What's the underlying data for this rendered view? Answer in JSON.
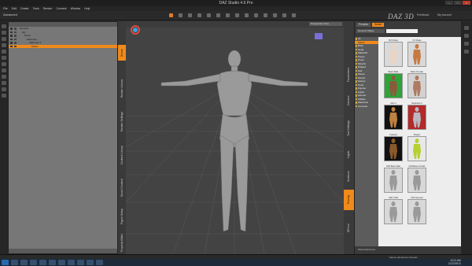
{
  "window": {
    "title": "DAZ Studio 4.6 Pro",
    "minimize": "–",
    "maximize": "□",
    "close": "×"
  },
  "menu": [
    "File",
    "Edit",
    "Create",
    "Tools",
    "Render",
    "Connect",
    "Window",
    "Help"
  ],
  "toolbar": {
    "layout": "Advanced",
    "logo": "DAZ 3D",
    "links": [
      "Feedback",
      "My Account"
    ]
  },
  "scene": {
    "rows": [
      {
        "label": "Genesis",
        "selected": false
      },
      {
        "label": "Hip",
        "selected": false
      },
      {
        "label": "Pelvis",
        "selected": false
      },
      {
        "label": "Abdomen",
        "selected": false
      },
      {
        "label": "Abdomen 2",
        "selected": false
      },
      {
        "label": "Chest",
        "selected": true
      }
    ]
  },
  "left_tabs": [
    "Scene",
    "Render Library",
    "Render Settings",
    "Content Library",
    "Smart Content",
    "Figure Setup",
    "Property Editor"
  ],
  "right_tabs": [
    "Parameters",
    "Camera",
    "Tool Settings",
    "Lights",
    "Surfaces",
    "Posing",
    "DForm"
  ],
  "viewport": {
    "camera": "Perspective View",
    "figure_color": "#9a9a9a",
    "grid_color": "#5a5a5a"
  },
  "library": {
    "tabs": [
      "Presets",
      "Smart"
    ],
    "active_tab": "Smart",
    "filter": "Genesis Shape",
    "tree": [
      {
        "label": "All",
        "selected": false
      },
      {
        "label": "Actors",
        "selected": true
      },
      {
        "label": "Body",
        "selected": false
      },
      {
        "label": "Head",
        "selected": false
      },
      {
        "label": "Materials",
        "selected": false
      },
      {
        "label": "Poses",
        "selected": false
      },
      {
        "label": "Props",
        "selected": false
      },
      {
        "label": "Morphs",
        "selected": false
      },
      {
        "label": "Shapes",
        "selected": false
      },
      {
        "label": "Hair",
        "selected": false
      },
      {
        "label": "Shoes",
        "selected": false
      },
      {
        "label": "Scripts",
        "selected": false
      },
      {
        "label": "Setups",
        "selected": false
      },
      {
        "label": "Tools",
        "selected": false
      },
      {
        "label": "Figures",
        "selected": false
      },
      {
        "label": "Lights",
        "selected": false
      },
      {
        "label": "Scenes",
        "selected": false
      },
      {
        "label": "Utilities",
        "selected": false
      },
      {
        "label": "Wardrobe",
        "selected": false
      },
      {
        "label": "Cameras",
        "selected": false
      }
    ],
    "items": [
      {
        "caption": "M4 Shape",
        "color": "#e9d5c5",
        "bg": "#d9d9d9"
      },
      {
        "caption": "V4 Shape",
        "color": "#c67a42",
        "bg": "#d9d9d9"
      },
      {
        "caption": "Basic Male",
        "color": "#8b5a3c",
        "bg": "#2fa23a"
      },
      {
        "caption": "Basic Female",
        "color": "#b07a62",
        "bg": "#d2d2d2"
      },
      {
        "caption": "Aiko 4",
        "color": "#c08040",
        "bg": "#111"
      },
      {
        "caption": "Stephanie 4",
        "color": "#b8b8c0",
        "bg": "#b22a2a"
      },
      {
        "caption": "Creature",
        "color": "#8a5a2a",
        "bg": "#111"
      },
      {
        "caption": "Dragon",
        "color": "#b8d030",
        "bg": "#e8e8e8"
      },
      {
        "caption": "AVR Base Male",
        "color": "#9a9a9a",
        "bg": "#d8d8d8"
      },
      {
        "caption": "AVR Base Female",
        "color": "#9a9a9a",
        "bg": "#d8d8d8"
      },
      {
        "caption": "AVR Child",
        "color": "#9a9a9a",
        "bg": "#d8d8d8"
      },
      {
        "caption": "AVR Genesis",
        "color": "#9a9a9a",
        "bg": "#d8d8d8"
      }
    ],
    "footer_tag": "Show Sub Items"
  },
  "status": {
    "text": "Figure selected to Genesis",
    "time": "10:21 AM",
    "date": "11/22/2013"
  }
}
